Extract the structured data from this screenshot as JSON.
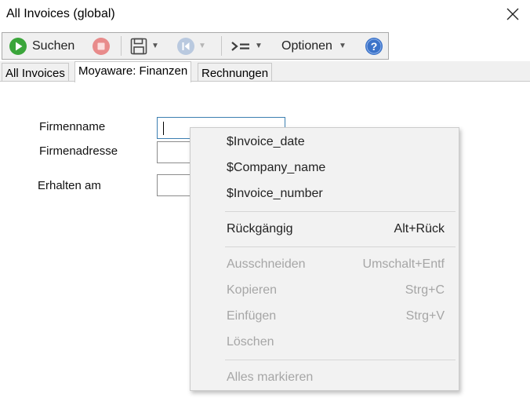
{
  "window": {
    "title": "All Invoices (global)"
  },
  "toolbar": {
    "search_label": "Suchen",
    "options_label": "Optionen",
    "icons": [
      "play-icon",
      "stop-icon",
      "save-icon",
      "first-record-icon",
      "goto-icon",
      "help-icon"
    ]
  },
  "tabs": [
    {
      "label": "All Invoices"
    },
    {
      "label": "Moyaware: Finanzen",
      "active": true
    },
    {
      "label": "Rechnungen"
    }
  ],
  "form": {
    "fields": [
      {
        "label": "Firmenname",
        "value": ""
      },
      {
        "label": "Firmenadresse",
        "value": ""
      },
      {
        "label": "Erhalten am",
        "value": ""
      }
    ]
  },
  "context_menu": {
    "items": [
      {
        "label": "$Invoice_date",
        "shortcut": "",
        "enabled": true
      },
      {
        "label": "$Company_name",
        "shortcut": "",
        "enabled": true
      },
      {
        "label": "$Invoice_number",
        "shortcut": "",
        "enabled": true
      },
      {
        "label": "Rückgängig",
        "shortcut": "Alt+Rück",
        "enabled": true
      },
      {
        "label": "Ausschneiden",
        "shortcut": "Umschalt+Entf",
        "enabled": false
      },
      {
        "label": "Kopieren",
        "shortcut": "Strg+C",
        "enabled": false
      },
      {
        "label": "Einfügen",
        "shortcut": "Strg+V",
        "enabled": false
      },
      {
        "label": "Löschen",
        "shortcut": "",
        "enabled": false
      },
      {
        "label": "Alles markieren",
        "shortcut": "",
        "enabled": false
      }
    ]
  },
  "colors": {
    "play_green": "#3aa53a",
    "stop_red": "#e88b8b",
    "help_blue": "#3b73c9"
  }
}
